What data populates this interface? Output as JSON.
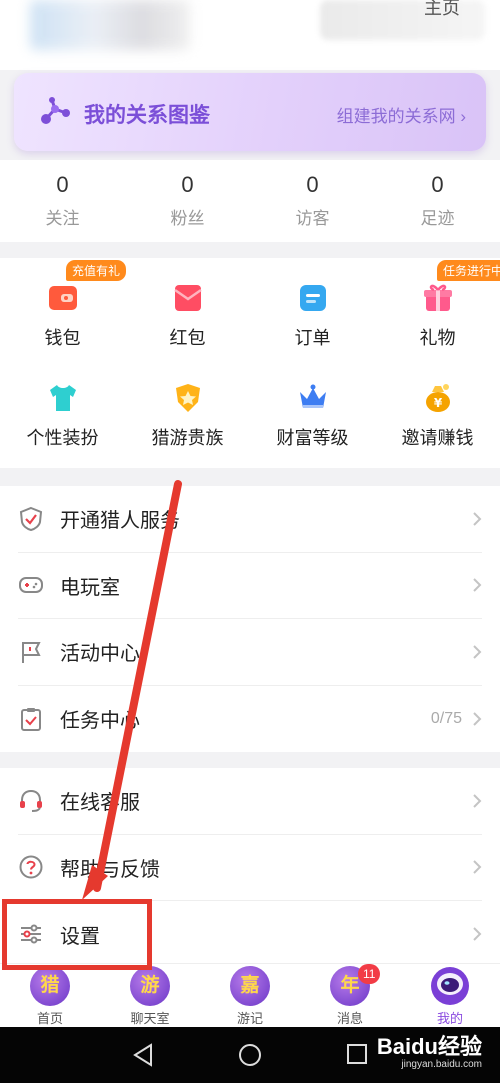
{
  "header": {
    "homepage_label": "主页"
  },
  "relation_banner": {
    "title": "我的关系图鉴",
    "link": "组建我的关系网",
    "link_chevron": "›"
  },
  "stats": [
    {
      "value": "0",
      "label": "关注"
    },
    {
      "value": "0",
      "label": "粉丝"
    },
    {
      "value": "0",
      "label": "访客"
    },
    {
      "value": "0",
      "label": "足迹"
    }
  ],
  "features": [
    {
      "label": "钱包",
      "icon": "wallet-icon",
      "badge": "充值有礼",
      "badge_color": "#ff8a1c"
    },
    {
      "label": "红包",
      "icon": "red-envelope-icon"
    },
    {
      "label": "订单",
      "icon": "order-icon"
    },
    {
      "label": "礼物",
      "icon": "gift-icon",
      "badge": "任务进行中",
      "badge_color": "#ff8a1c"
    },
    {
      "label": "个性装扮",
      "icon": "tshirt-icon"
    },
    {
      "label": "猎游贵族",
      "icon": "noble-badge-icon"
    },
    {
      "label": "财富等级",
      "icon": "crown-icon"
    },
    {
      "label": "邀请赚钱",
      "icon": "money-bag-icon"
    }
  ],
  "menu_group_1": [
    {
      "label": "开通猎人服务",
      "icon": "shield-check-icon"
    },
    {
      "label": "电玩室",
      "icon": "gamepad-icon"
    },
    {
      "label": "活动中心",
      "icon": "flag-icon"
    },
    {
      "label": "任务中心",
      "icon": "clipboard-check-icon",
      "value": "0/75"
    }
  ],
  "menu_group_2": [
    {
      "label": "在线客服",
      "icon": "headset-icon"
    },
    {
      "label": "帮助与反馈",
      "icon": "question-icon"
    },
    {
      "label": "设置",
      "icon": "sliders-icon"
    }
  ],
  "bottom_nav": [
    {
      "label": "首页",
      "glyph": "猎"
    },
    {
      "label": "聊天室",
      "glyph": "游"
    },
    {
      "label": "游记",
      "glyph": "嘉"
    },
    {
      "label": "消息",
      "glyph": "年",
      "badge": "11"
    },
    {
      "label": "我的",
      "glyph": "",
      "active": true
    }
  ],
  "watermark": {
    "logo": "Baidu经验",
    "sub": "jingyan.baidu.com"
  },
  "colors": {
    "accent": "#8a4be0",
    "banner_title": "#7b4fd8",
    "annotation_red": "#e5392e",
    "badge_red": "#f23c46"
  }
}
